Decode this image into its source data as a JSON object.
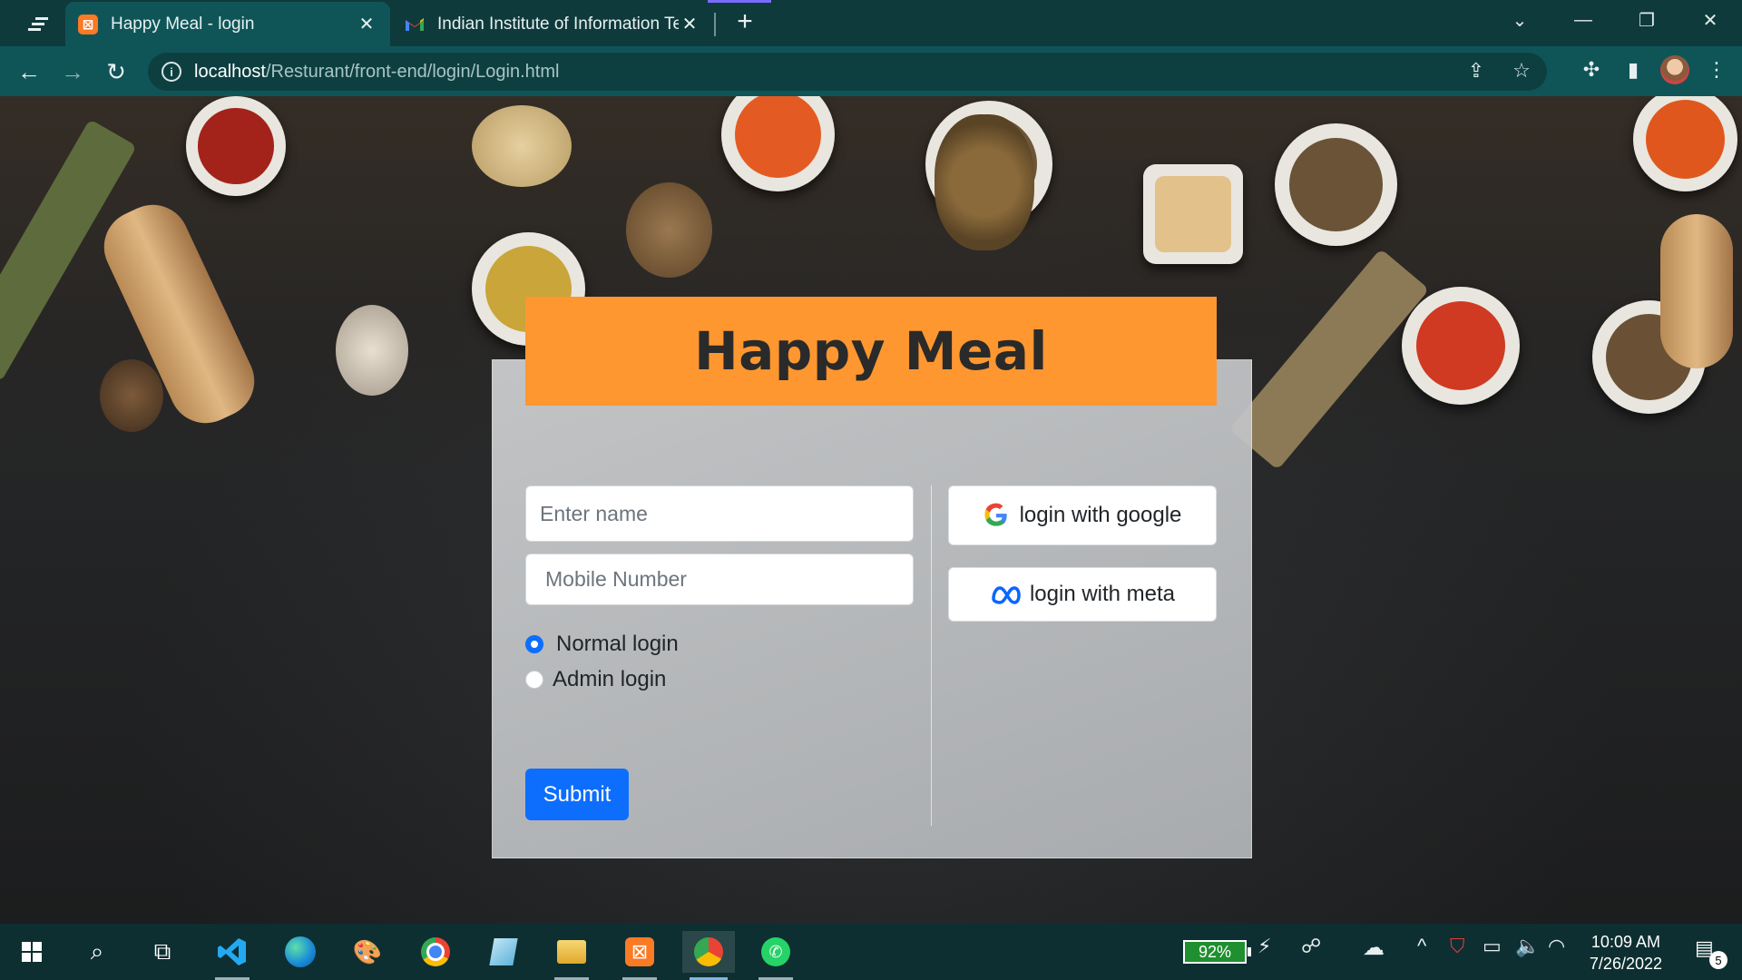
{
  "browser": {
    "tabs": [
      {
        "title": "Happy Meal - login",
        "favicon": "xampp-icon",
        "active": true
      },
      {
        "title": "Indian Institute of Information Te",
        "favicon": "gmail-icon",
        "active": false
      }
    ],
    "address": {
      "host": "localhost",
      "path": "/Resturant/front-end/login/Login.html"
    }
  },
  "page": {
    "brand": "Happy Meal",
    "form": {
      "name_placeholder": "Enter name",
      "mobile_placeholder": "Mobile Number",
      "radio_options": [
        {
          "label": "Normal login",
          "checked": true
        },
        {
          "label": "Admin login",
          "checked": false
        }
      ],
      "submit_label": "Submit"
    },
    "oauth": {
      "google_label": "login with google",
      "meta_label": "login with meta"
    },
    "colors": {
      "brand_bar": "#ff9730",
      "primary": "#0d6efd"
    }
  },
  "taskbar": {
    "battery_percent": "92%",
    "time": "10:09 AM",
    "date": "7/26/2022",
    "notification_count": "5"
  }
}
